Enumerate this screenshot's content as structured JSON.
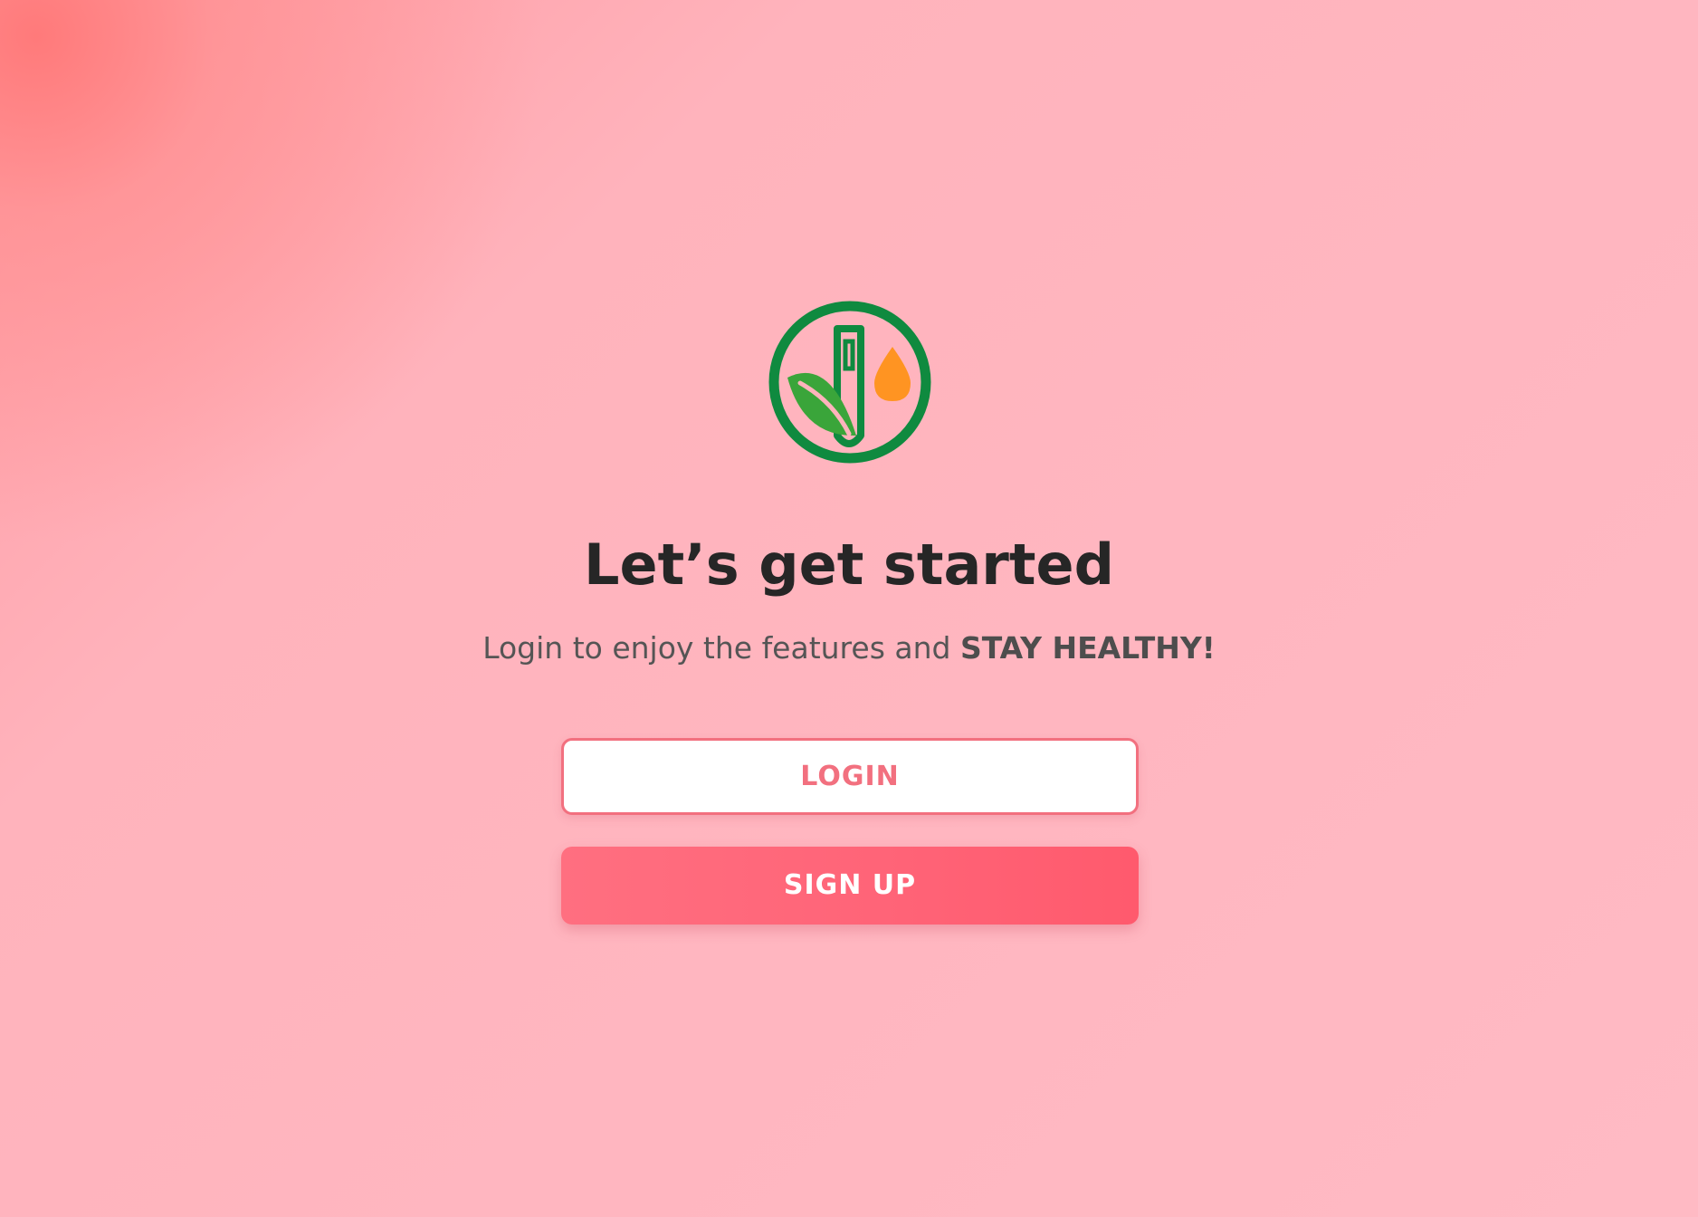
{
  "logo": {
    "icon": "leaf-pen-drop-logo",
    "ring_color": "#0f8a3f",
    "leaf_color": "#3aa53a",
    "drop_color": "#ff9422"
  },
  "heading": {
    "title": "Let’s get started",
    "subtitle_prefix": "Login to enjoy the features and ",
    "subtitle_emphasis": "STAY HEALTHY!"
  },
  "actions": {
    "login_label": "LOGIN",
    "signup_label": "SIGN UP"
  },
  "colors": {
    "accent": "#f2707f",
    "signup_bg": "#ff6478",
    "title_text": "#262626",
    "subtitle_text": "#555555"
  }
}
